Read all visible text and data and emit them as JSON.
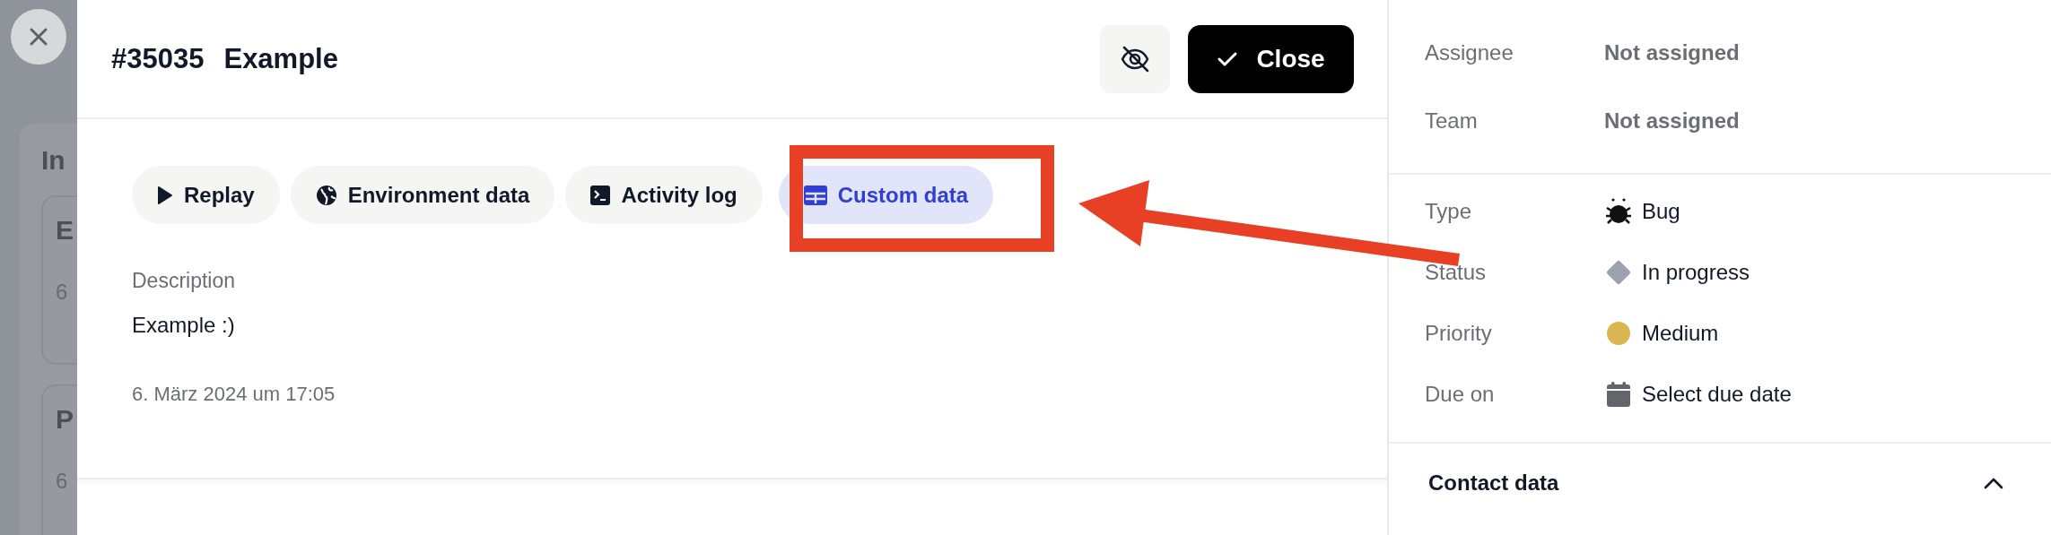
{
  "background": {
    "heading": "In",
    "cards": [
      {
        "title": "E",
        "meta": "6"
      },
      {
        "title": "P",
        "meta": "6"
      }
    ]
  },
  "issue": {
    "number": "#35035",
    "title": "Example"
  },
  "close_button": {
    "label": "Close"
  },
  "tabs": [
    {
      "label": "Replay",
      "selected": false
    },
    {
      "label": "Environment data",
      "selected": false
    },
    {
      "label": "Activity log",
      "selected": false
    },
    {
      "label": "Custom data",
      "selected": true
    }
  ],
  "description": {
    "label": "Description",
    "text": "Example :)"
  },
  "timestamp": "6. März 2024 um 17:05",
  "people": [
    {
      "label": "Assignee",
      "value": "Not assigned"
    },
    {
      "label": "Team",
      "value": "Not assigned"
    }
  ],
  "attributes": [
    {
      "kind": "type",
      "label": "Type",
      "value": "Bug"
    },
    {
      "kind": "status",
      "label": "Status",
      "value": "In progress",
      "color": "#9ca3af"
    },
    {
      "kind": "priority",
      "label": "Priority",
      "value": "Medium",
      "color": "#dbb552"
    },
    {
      "kind": "due",
      "label": "Due on",
      "value": "Select due date"
    }
  ],
  "contact_section": {
    "title": "Contact data",
    "expanded": true
  }
}
